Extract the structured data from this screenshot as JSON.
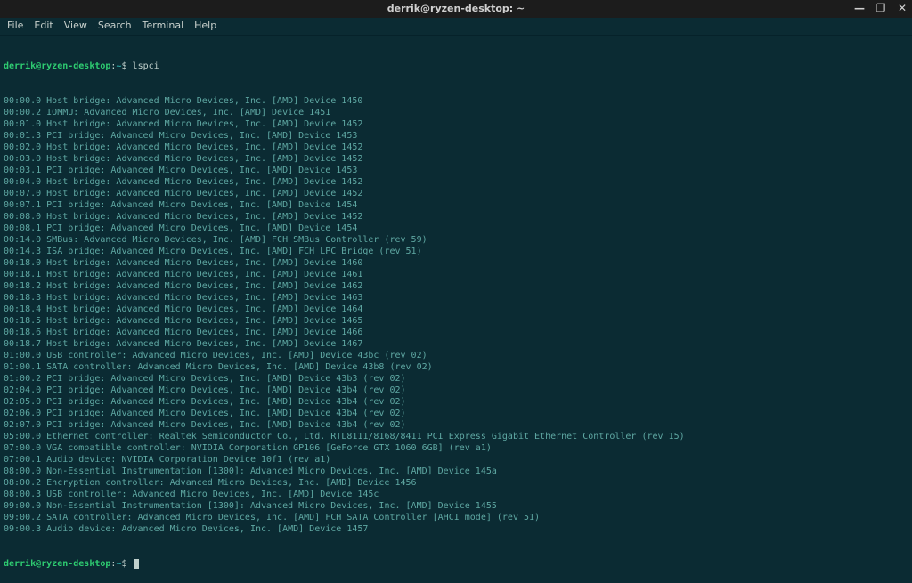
{
  "titlebar": {
    "title": "derrik@ryzen-desktop: ~"
  },
  "window_controls": {
    "minimize": "—",
    "maximize": "❐",
    "close": "✕"
  },
  "menubar": {
    "file": "File",
    "edit": "Edit",
    "view": "View",
    "search": "Search",
    "terminal": "Terminal",
    "help": "Help"
  },
  "prompt": {
    "user_host": "derrik@ryzen-desktop",
    "sep": ":",
    "path": "~",
    "dollar": "$"
  },
  "command": "lspci",
  "output_lines": [
    "00:00.0 Host bridge: Advanced Micro Devices, Inc. [AMD] Device 1450",
    "00:00.2 IOMMU: Advanced Micro Devices, Inc. [AMD] Device 1451",
    "00:01.0 Host bridge: Advanced Micro Devices, Inc. [AMD] Device 1452",
    "00:01.3 PCI bridge: Advanced Micro Devices, Inc. [AMD] Device 1453",
    "00:02.0 Host bridge: Advanced Micro Devices, Inc. [AMD] Device 1452",
    "00:03.0 Host bridge: Advanced Micro Devices, Inc. [AMD] Device 1452",
    "00:03.1 PCI bridge: Advanced Micro Devices, Inc. [AMD] Device 1453",
    "00:04.0 Host bridge: Advanced Micro Devices, Inc. [AMD] Device 1452",
    "00:07.0 Host bridge: Advanced Micro Devices, Inc. [AMD] Device 1452",
    "00:07.1 PCI bridge: Advanced Micro Devices, Inc. [AMD] Device 1454",
    "00:08.0 Host bridge: Advanced Micro Devices, Inc. [AMD] Device 1452",
    "00:08.1 PCI bridge: Advanced Micro Devices, Inc. [AMD] Device 1454",
    "00:14.0 SMBus: Advanced Micro Devices, Inc. [AMD] FCH SMBus Controller (rev 59)",
    "00:14.3 ISA bridge: Advanced Micro Devices, Inc. [AMD] FCH LPC Bridge (rev 51)",
    "00:18.0 Host bridge: Advanced Micro Devices, Inc. [AMD] Device 1460",
    "00:18.1 Host bridge: Advanced Micro Devices, Inc. [AMD] Device 1461",
    "00:18.2 Host bridge: Advanced Micro Devices, Inc. [AMD] Device 1462",
    "00:18.3 Host bridge: Advanced Micro Devices, Inc. [AMD] Device 1463",
    "00:18.4 Host bridge: Advanced Micro Devices, Inc. [AMD] Device 1464",
    "00:18.5 Host bridge: Advanced Micro Devices, Inc. [AMD] Device 1465",
    "00:18.6 Host bridge: Advanced Micro Devices, Inc. [AMD] Device 1466",
    "00:18.7 Host bridge: Advanced Micro Devices, Inc. [AMD] Device 1467",
    "01:00.0 USB controller: Advanced Micro Devices, Inc. [AMD] Device 43bc (rev 02)",
    "01:00.1 SATA controller: Advanced Micro Devices, Inc. [AMD] Device 43b8 (rev 02)",
    "01:00.2 PCI bridge: Advanced Micro Devices, Inc. [AMD] Device 43b3 (rev 02)",
    "02:04.0 PCI bridge: Advanced Micro Devices, Inc. [AMD] Device 43b4 (rev 02)",
    "02:05.0 PCI bridge: Advanced Micro Devices, Inc. [AMD] Device 43b4 (rev 02)",
    "02:06.0 PCI bridge: Advanced Micro Devices, Inc. [AMD] Device 43b4 (rev 02)",
    "02:07.0 PCI bridge: Advanced Micro Devices, Inc. [AMD] Device 43b4 (rev 02)",
    "05:00.0 Ethernet controller: Realtek Semiconductor Co., Ltd. RTL8111/8168/8411 PCI Express Gigabit Ethernet Controller (rev 15)",
    "07:00.0 VGA compatible controller: NVIDIA Corporation GP106 [GeForce GTX 1060 6GB] (rev a1)",
    "07:00.1 Audio device: NVIDIA Corporation Device 10f1 (rev a1)",
    "08:00.0 Non-Essential Instrumentation [1300]: Advanced Micro Devices, Inc. [AMD] Device 145a",
    "08:00.2 Encryption controller: Advanced Micro Devices, Inc. [AMD] Device 1456",
    "08:00.3 USB controller: Advanced Micro Devices, Inc. [AMD] Device 145c",
    "09:00.0 Non-Essential Instrumentation [1300]: Advanced Micro Devices, Inc. [AMD] Device 1455",
    "09:00.2 SATA controller: Advanced Micro Devices, Inc. [AMD] FCH SATA Controller [AHCI mode] (rev 51)",
    "09:00.3 Audio device: Advanced Micro Devices, Inc. [AMD] Device 1457"
  ]
}
